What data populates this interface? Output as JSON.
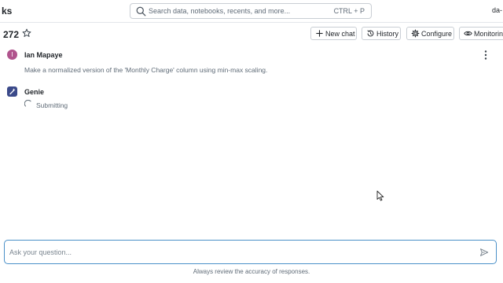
{
  "header": {
    "app_name_fragment": "ks",
    "search_placeholder": "Search data, notebooks, recents, and more...",
    "search_shortcut": "CTRL + P",
    "user_fragment": "da-"
  },
  "page": {
    "title": "272"
  },
  "toolbar": {
    "new_chat": "New chat",
    "history": "History",
    "configure": "Configure",
    "monitoring": "Monitoring"
  },
  "messages": [
    {
      "avatar_initial": "I",
      "author": "Ian Mapaye",
      "text": "Make a normalized version of the 'Monthly Charge' column using min-max scaling."
    },
    {
      "author": "Genie",
      "status": "Submitting"
    }
  ],
  "composer": {
    "placeholder": "Ask your question...",
    "disclaimer": "Always review the accuracy of responses."
  },
  "colors": {
    "accent": "#4a90c8",
    "user_avatar": "#b0548d",
    "genie_avatar": "#3b4a8a"
  }
}
